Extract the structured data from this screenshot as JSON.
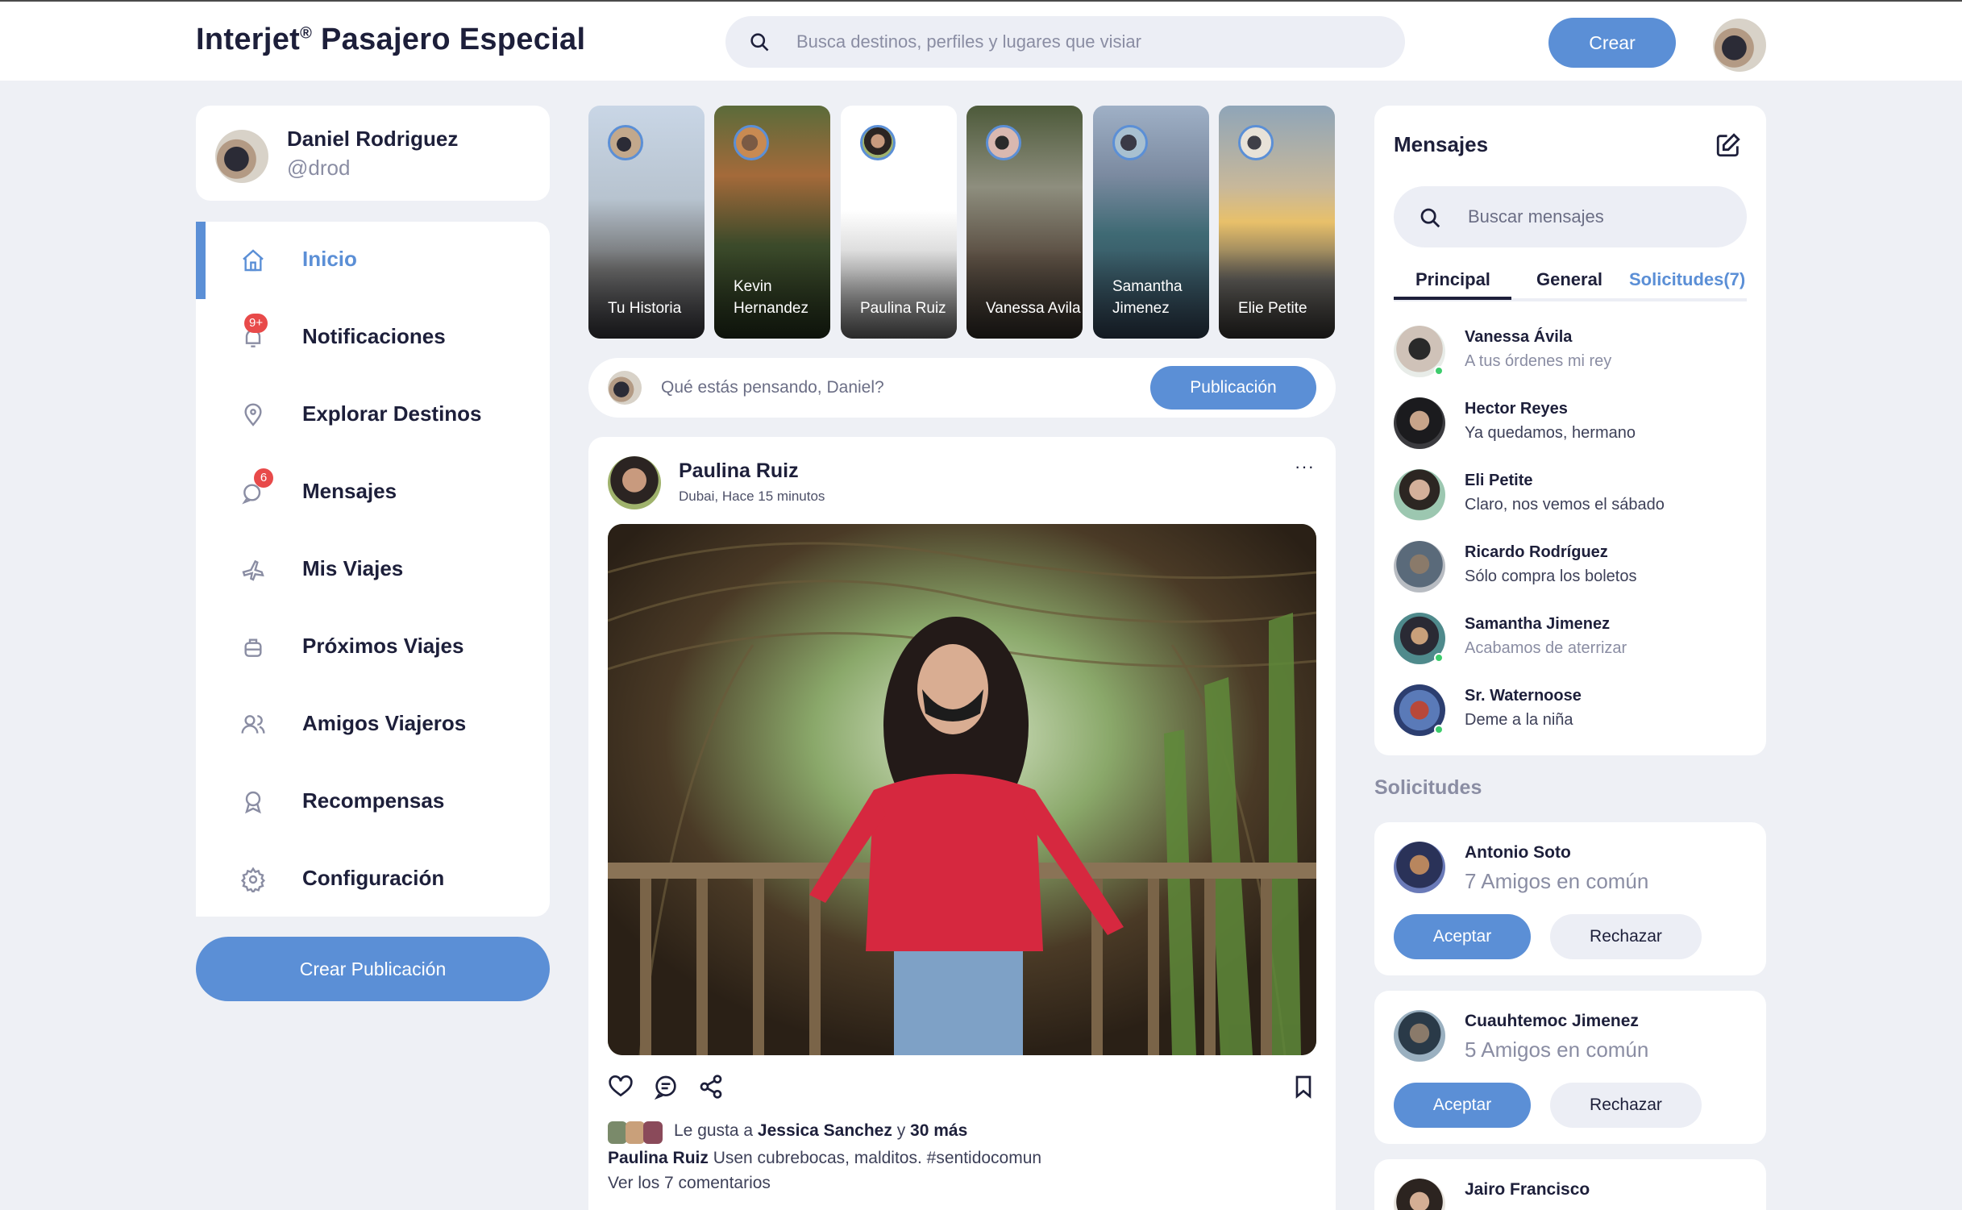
{
  "header": {
    "brand": "Interjet",
    "brand_mark": "®",
    "brand_suffix": " Pasajero Especial",
    "search_placeholder": "Busca destinos, perfiles y lugares que visiar",
    "create_label": "Crear"
  },
  "profile": {
    "name": "Daniel Rodriguez",
    "handle": "@drod"
  },
  "nav": {
    "items": [
      {
        "label": "Inicio",
        "icon": "home-icon"
      },
      {
        "label": "Notificaciones",
        "icon": "bell-icon",
        "badge": "9+"
      },
      {
        "label": "Explorar Destinos",
        "icon": "map-pin-icon"
      },
      {
        "label": "Mensajes",
        "icon": "chat-icon",
        "badge": "6"
      },
      {
        "label": "Mis Viajes",
        "icon": "plane-icon"
      },
      {
        "label": "Próximos Viajes",
        "icon": "luggage-icon"
      },
      {
        "label": "Amigos Viajeros",
        "icon": "users-icon"
      },
      {
        "label": "Recompensas",
        "icon": "award-icon"
      },
      {
        "label": "Configuración",
        "icon": "gear-icon"
      }
    ],
    "create_post_label": "Crear Publicación"
  },
  "stories": [
    {
      "name": "Tu Historia"
    },
    {
      "name": "Kevin Hernandez"
    },
    {
      "name": "Paulina Ruiz"
    },
    {
      "name": "Vanessa Avila"
    },
    {
      "name": "Samantha Jimenez"
    },
    {
      "name": "Elie Petite"
    }
  ],
  "composer": {
    "placeholder": "Qué estás pensando, Daniel?",
    "button_label": "Publicación"
  },
  "post": {
    "author": "Paulina Ruiz",
    "meta": "Dubai, Hace 15 minutos",
    "more": "···",
    "likes_prefix": "Le gusta a ",
    "likes_name": "Jessica Sanchez",
    "likes_connector": " y ",
    "likes_more": "30 más",
    "caption_author": "Paulina Ruiz",
    "caption_text": " Usen cubrebocas, malditos. #sentidocomun",
    "comments_link": "Ver los 7 comentarios"
  },
  "messages": {
    "title": "Mensajes",
    "search_placeholder": "Buscar mensajes",
    "tabs": [
      {
        "label": "Principal"
      },
      {
        "label": "General"
      },
      {
        "label": "Solicitudes(7)"
      }
    ],
    "items": [
      {
        "name": "Vanessa Ávila",
        "text": "A tus órdenes mi rey",
        "muted": true,
        "online": true
      },
      {
        "name": "Hector Reyes",
        "text": "Ya quedamos, hermano",
        "muted": false,
        "online": false
      },
      {
        "name": "Eli Petite",
        "text": "Claro, nos vemos el sábado",
        "muted": false,
        "online": false
      },
      {
        "name": "Ricardo Rodríguez",
        "text": "Sólo compra los boletos",
        "muted": false,
        "online": false
      },
      {
        "name": "Samantha Jimenez",
        "text": "Acabamos de aterrizar",
        "muted": true,
        "online": true
      },
      {
        "name": "Sr. Waternoose",
        "text": "Deme a la niña",
        "muted": false,
        "online": true
      }
    ]
  },
  "requests": {
    "heading": "Solicitudes",
    "accept_label": "Aceptar",
    "reject_label": "Rechazar",
    "items": [
      {
        "name": "Antonio Soto",
        "mutual": "7 Amigos en común"
      },
      {
        "name": "Cuauhtemoc Jimenez",
        "mutual": "5 Amigos en común"
      },
      {
        "name": "Jairo Francisco",
        "mutual": ""
      }
    ]
  },
  "colors": {
    "accent": "#5b8fd6",
    "background": "#eef0f5",
    "text": "#1d1f3a",
    "badge": "#e84a4a",
    "online": "#3dcc6c"
  }
}
